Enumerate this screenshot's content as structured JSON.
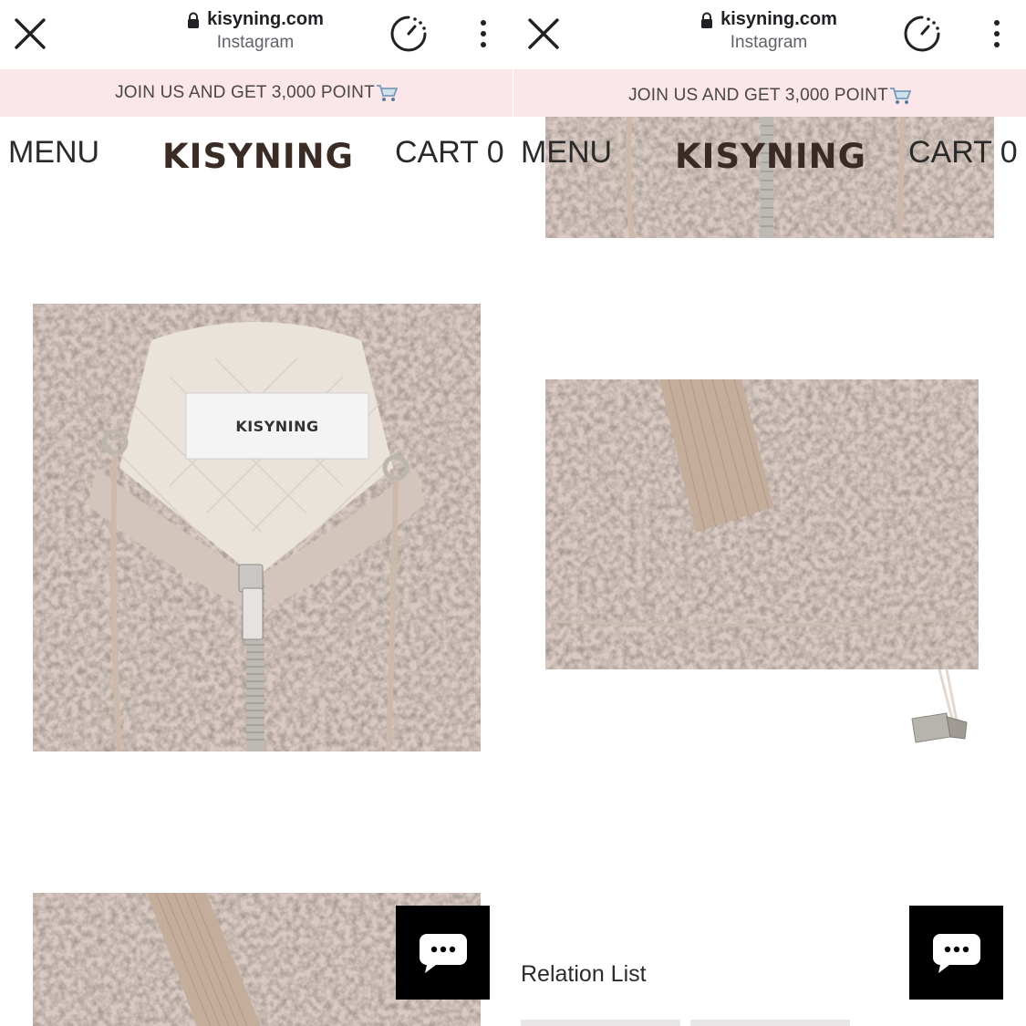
{
  "browser": {
    "domain": "kisyning.com",
    "source": "Instagram",
    "icons": [
      "close-icon",
      "lock-icon",
      "timer-icon",
      "more-vert-icon"
    ]
  },
  "promo": {
    "text": "JOIN US AND GET 3,000 POINT",
    "emoji_icon": "shopping-cart-icon",
    "background": "#fbe6ea"
  },
  "nav": {
    "menu_label": "MENU",
    "brand": "KISYNING",
    "cart_label": "CART 0"
  },
  "product": {
    "label_text": "KISYNING",
    "fabric_color": "#d9cbc3"
  },
  "relation": {
    "title": "Relation List"
  },
  "chat": {
    "icon": "chat-bubble-icon"
  }
}
